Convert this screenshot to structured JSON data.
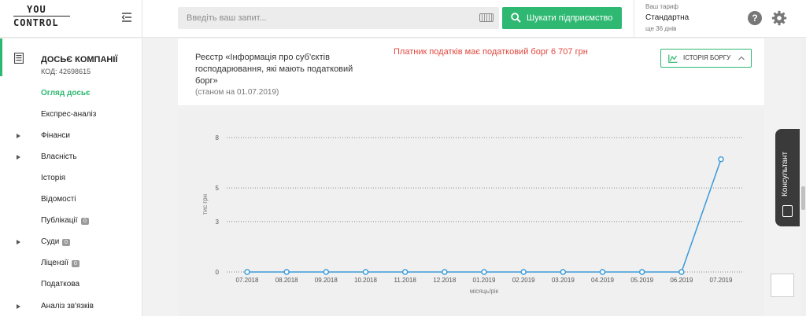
{
  "header": {
    "logo_top": "YOU",
    "logo_bottom": "CONTROL",
    "search_placeholder": "Введіть ваш запит...",
    "search_button_label": "Шукати підприємство",
    "tariff_caption": "Ваш тариф",
    "tariff_name": "Стандартна",
    "tariff_days": "ще 36 днів",
    "help_label": "?",
    "accent_color": "#2eb872"
  },
  "sidebar": {
    "dossier_title": "ДОСЬЄ КОМПАНІЇ",
    "dossier_code": "КОД: 42698615",
    "items": [
      {
        "label": "Огляд досьє",
        "active": true,
        "caret": false,
        "badge": ""
      },
      {
        "label": "Експрес-аналіз",
        "active": false,
        "caret": false,
        "badge": ""
      },
      {
        "label": "Фінанси",
        "active": false,
        "caret": true,
        "badge": ""
      },
      {
        "label": "Власність",
        "active": false,
        "caret": true,
        "badge": ""
      },
      {
        "label": "Історія",
        "active": false,
        "caret": false,
        "badge": ""
      },
      {
        "label": "Відомості",
        "active": false,
        "caret": false,
        "badge": ""
      },
      {
        "label": "Публікації",
        "active": false,
        "caret": false,
        "badge": "0"
      },
      {
        "label": "Суди",
        "active": false,
        "caret": true,
        "badge": "0"
      },
      {
        "label": "Ліцензії",
        "active": false,
        "caret": false,
        "badge": "0"
      },
      {
        "label": "Податкова",
        "active": false,
        "caret": false,
        "badge": ""
      },
      {
        "label": "Аналіз зв'язків",
        "active": false,
        "caret": true,
        "badge": ""
      }
    ]
  },
  "registry": {
    "title": "Реєстр «Інформація про суб'єктів господарювання, які мають податковий борг»",
    "as_of": "(станом на 01.07.2019)",
    "debt_message": "Платник податків має податковий борг 6 707 грн",
    "debt_color": "#e0473d",
    "history_button_label": "ІСТОРІЯ БОРГУ"
  },
  "chart_data": {
    "type": "line",
    "xlabel": "місяць/рік",
    "ylabel": "тис грн",
    "ylim": [
      0,
      8
    ],
    "yticks": [
      0,
      3,
      5,
      8
    ],
    "categories": [
      "07.2018",
      "08.2018",
      "09.2018",
      "10.2018",
      "11.2018",
      "12.2018",
      "01.2019",
      "02.2019",
      "03.2019",
      "04.2019",
      "05.2019",
      "06.2019",
      "07.2019"
    ],
    "values": [
      0,
      0,
      0,
      0,
      0,
      0,
      0,
      0,
      0,
      0,
      0,
      0,
      6.707
    ],
    "grid": true,
    "line_color": "#3a9ad9"
  },
  "floating": {
    "consultant_label": "Консультант"
  }
}
